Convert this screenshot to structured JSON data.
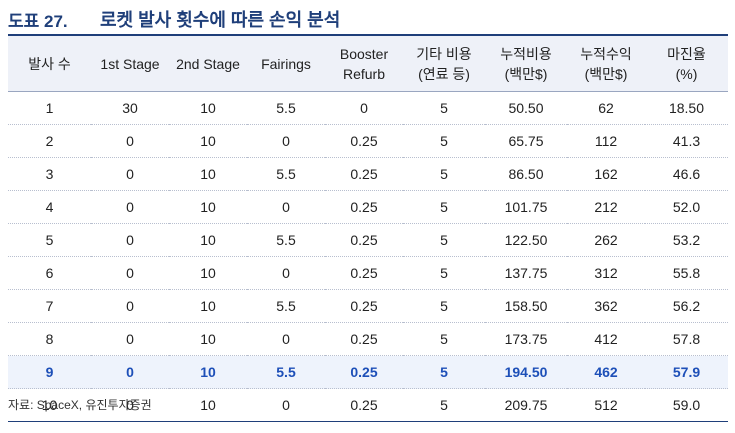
{
  "figure": {
    "number": "도표 27.",
    "title": "로켓 발사 횟수에 따른 손익 분석"
  },
  "table": {
    "headers": [
      [
        "발사 수"
      ],
      [
        "1st Stage"
      ],
      [
        "2nd Stage"
      ],
      [
        "Fairings"
      ],
      [
        "Booster",
        "Refurb"
      ],
      [
        "기타 비용",
        "(연료 등)"
      ],
      [
        "누적비용",
        "(백만$)"
      ],
      [
        "누적수익",
        "(백만$)"
      ],
      [
        "마진율",
        "(%)"
      ]
    ],
    "rows": [
      [
        "1",
        "30",
        "10",
        "5.5",
        "0",
        "5",
        "50.50",
        "62",
        "18.50"
      ],
      [
        "2",
        "0",
        "10",
        "0",
        "0.25",
        "5",
        "65.75",
        "112",
        "41.3"
      ],
      [
        "3",
        "0",
        "10",
        "5.5",
        "0.25",
        "5",
        "86.50",
        "162",
        "46.6"
      ],
      [
        "4",
        "0",
        "10",
        "0",
        "0.25",
        "5",
        "101.75",
        "212",
        "52.0"
      ],
      [
        "5",
        "0",
        "10",
        "5.5",
        "0.25",
        "5",
        "122.50",
        "262",
        "53.2"
      ],
      [
        "6",
        "0",
        "10",
        "0",
        "0.25",
        "5",
        "137.75",
        "312",
        "55.8"
      ],
      [
        "7",
        "0",
        "10",
        "5.5",
        "0.25",
        "5",
        "158.50",
        "362",
        "56.2"
      ],
      [
        "8",
        "0",
        "10",
        "0",
        "0.25",
        "5",
        "173.75",
        "412",
        "57.8"
      ],
      [
        "9",
        "0",
        "10",
        "5.5",
        "0.25",
        "5",
        "194.50",
        "462",
        "57.9"
      ],
      [
        "10",
        "0",
        "10",
        "0",
        "0.25",
        "5",
        "209.75",
        "512",
        "59.0"
      ]
    ],
    "highlighted_row": 8,
    "highlight_color": "#1d4fb8",
    "header_bg": "#eef1f8"
  },
  "source": "자료: SpaceX, 유진투자증권"
}
